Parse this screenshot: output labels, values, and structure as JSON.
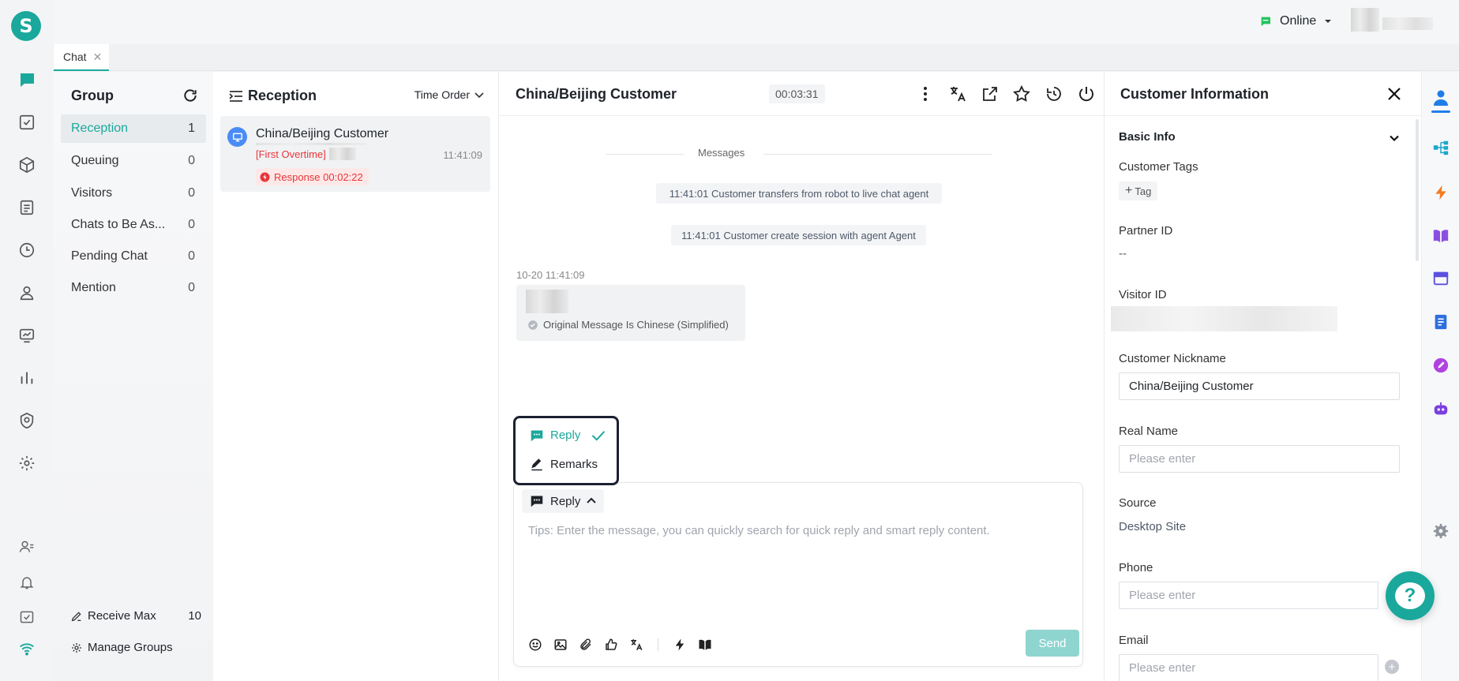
{
  "app": {
    "logo_letter": "S"
  },
  "topbar": {
    "status_label": "Online"
  },
  "tabs": [
    {
      "label": "Chat",
      "close": "✕"
    }
  ],
  "group_panel": {
    "title": "Group",
    "items": [
      {
        "label": "Reception",
        "count": "1"
      },
      {
        "label": "Queuing",
        "count": "0"
      },
      {
        "label": "Visitors",
        "count": "0"
      },
      {
        "label": "Chats to Be As...",
        "count": "0"
      },
      {
        "label": "Pending Chat",
        "count": "0"
      },
      {
        "label": "Mention",
        "count": "0"
      }
    ],
    "receive_max_label": "Receive Max",
    "receive_max_value": "10",
    "manage_groups_label": "Manage Groups"
  },
  "reception": {
    "title": "Reception",
    "sort_label": "Time Order",
    "sessions": [
      {
        "name": "China/Beijing Customer",
        "tag": "[First Overtime]",
        "time": "11:41:09",
        "response": "Response 00:02:22"
      }
    ]
  },
  "chat": {
    "title": "China/Beijing Customer",
    "timer": "00:03:31",
    "divider_label": "Messages",
    "system_messages": [
      "11:41:01 Customer transfers from robot to live chat agent",
      "11:41:01 Customer create session with agent Agent"
    ],
    "message": {
      "timestamp": "10-20 11:41:09",
      "translation_note": "Original Message Is Chinese (Simplified)"
    },
    "mode_menu": {
      "options": [
        {
          "label": "Reply"
        },
        {
          "label": "Remarks"
        }
      ]
    },
    "mode_selected": "Reply",
    "input_placeholder": "Tips: Enter the message, you can quickly search for quick reply and smart reply content.",
    "send_label": "Send"
  },
  "customer_info": {
    "title": "Customer Information",
    "section_title": "Basic Info",
    "tags_label": "Customer Tags",
    "tag_button": "Tag",
    "partner_id_label": "Partner ID",
    "partner_id_value": "--",
    "visitor_id_label": "Visitor ID",
    "nickname_label": "Customer Nickname",
    "nickname_value": "China/Beijing Customer",
    "real_name_label": "Real Name",
    "real_name_placeholder": "Please enter",
    "source_label": "Source",
    "source_value": "Desktop Site",
    "phone_label": "Phone",
    "phone_placeholder": "Please enter",
    "email_label": "Email",
    "email_placeholder": "Please enter"
  },
  "help": {
    "label": "?"
  },
  "colors": {
    "brand": "#1aa89c",
    "danger": "#e8363a",
    "send_disabled": "#8fd5cf"
  }
}
